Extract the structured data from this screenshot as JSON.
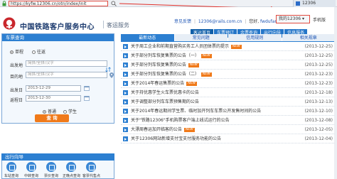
{
  "browser": {
    "url": "https://kyfw.12306.cn/otn/index/init",
    "tab_label": "12306"
  },
  "header": {
    "brand": "中国铁路客户服务中心",
    "subtitle": "客运服务",
    "welcome_prefix": "意见反馈",
    "email": "12306@rails.com.cn",
    "welcome": "您好,",
    "username": "fwdufan",
    "logout": "退出",
    "my_account": "我的12306",
    "mobile": "手机版"
  },
  "nav": [
    {
      "label": "客运首页",
      "active": true
    },
    {
      "label": "车票预订",
      "active": false
    },
    {
      "label": "余票查询",
      "active": false
    },
    {
      "label": "出行向导",
      "active": false
    },
    {
      "label": "信息服务",
      "active": false
    }
  ],
  "ticket_search": {
    "title": "车票查询",
    "trip_types": [
      {
        "label": "单程",
        "selected": true
      },
      {
        "label": "往返",
        "selected": false
      }
    ],
    "from_label": "出发地",
    "from_placeholder": "简拼/全拼/汉字",
    "to_label": "目的地",
    "to_placeholder": "简拼/全拼/汉字",
    "depart_label": "出发日",
    "depart_date": "2013-12-29",
    "return_label": "返程日",
    "return_date": "2013-12-30",
    "passenger_types": [
      {
        "label": "普通",
        "selected": true
      },
      {
        "label": "学生",
        "selected": false
      }
    ],
    "query_button": "查  询"
  },
  "guide": {
    "title": "出行向导",
    "items": [
      {
        "label": "车站查询",
        "icon": "station-icon"
      },
      {
        "label": "中转查询",
        "icon": "transfer-icon"
      },
      {
        "label": "票价查询",
        "icon": "price-icon"
      },
      {
        "label": "正晚点查询",
        "icon": "clock-icon"
      },
      {
        "label": "客票代售点",
        "icon": "ticket-icon"
      }
    ]
  },
  "news_tabs": [
    {
      "label": "最新动态",
      "active": true
    },
    {
      "label": "常见问题",
      "active": false
    },
    {
      "label": "信用规则",
      "active": false
    },
    {
      "label": "相关规章",
      "active": false
    }
  ],
  "news": [
    {
      "title": "关于周工企业和前期直营购买务工人员团体票的提示",
      "new": true,
      "date": "(2013-12-25)"
    },
    {
      "title": "关于部分列车恢复售票的公告（一）",
      "new": true,
      "date": "(2013-12-25)"
    },
    {
      "title": "关于部分列车恢复售票的公告",
      "new": true,
      "date": "(2013-12-25)"
    },
    {
      "title": "关于部分列车恢复售票的公告（二）",
      "new": true,
      "date": "(2013-12-23)"
    },
    {
      "title": "关于2014年春运售票的公告",
      "new": true,
      "date": "(2013-12-23)"
    },
    {
      "title": "关于持优惠学生火车票优惠卡的公告",
      "new": false,
      "date": "(2013-12-18)"
    },
    {
      "title": "关于调整部分列车车票预售期的公告",
      "new": false,
      "date": "(2013-12-13)"
    },
    {
      "title": "关于2014年春运期间学生票、临时加开列车车票公开发售时间的公告",
      "new": false,
      "date": "(2013-12-10)"
    },
    {
      "title": "关于\"铁路12306\"手机购票客户端上线试运行的公告",
      "new": false,
      "date": "(2013-12-08)"
    },
    {
      "title": "大漂周春运加开临客的公告",
      "new": true,
      "date": "(2013-12-05)"
    },
    {
      "title": "关于12306网站新增支付宝支付服务功能的公告",
      "new": false,
      "date": "(2013-12-04)"
    }
  ],
  "new_badge": "NEW"
}
